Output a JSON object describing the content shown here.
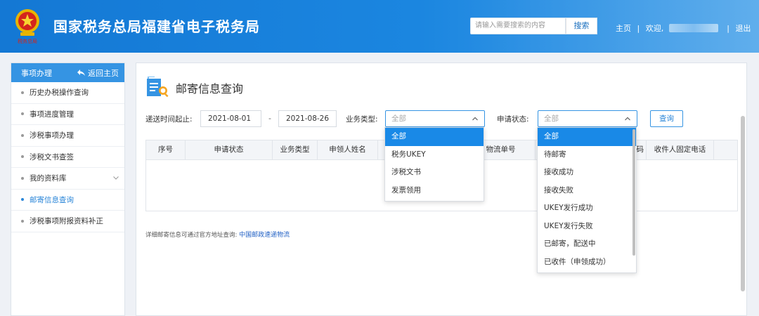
{
  "header": {
    "title": "国家税务总局福建省电子税务局",
    "emblem_caption": "税务总局",
    "search_placeholder": "请输入需要搜索的内容",
    "search_button": "搜索",
    "home": "主页",
    "sep1": "|",
    "welcome": "欢迎,",
    "sep2": "|",
    "logout": "退出"
  },
  "sidebar": {
    "section_title": "事项办理",
    "back_label": "返回主页",
    "items": [
      {
        "label": "历史办税操作查询"
      },
      {
        "label": "事项进度管理"
      },
      {
        "label": "涉税事项办理"
      },
      {
        "label": "涉税文书查签"
      },
      {
        "label": "我的资料库"
      },
      {
        "label": "邮寄信息查询"
      },
      {
        "label": "涉税事项附报资料补正"
      }
    ]
  },
  "main": {
    "title": "邮寄信息查询",
    "filters": {
      "date_label": "递送时间起止:",
      "date_from": "2021-08-01",
      "date_sep": "-",
      "date_to": "2021-08-26",
      "biz_type_label": "业务类型:",
      "biz_type_value": "全部",
      "status_label": "申请状态:",
      "status_value": "全部",
      "query_button": "查询"
    },
    "table": {
      "columns": [
        "序号",
        "申请状态",
        "业务类型",
        "申领人姓名",
        "",
        "物流单号",
        "",
        "码",
        "收件人固定电话"
      ]
    },
    "note_text": "详细邮寄信息可通过官方地址查询:",
    "note_link": "中国邮政速递物流"
  },
  "biz_type_dropdown": {
    "options": [
      "全部",
      "税务UKEY",
      "涉税文书",
      "发票领用"
    ],
    "selected": "全部"
  },
  "status_dropdown": {
    "options": [
      "全部",
      "待邮寄",
      "接收成功",
      "接收失败",
      "UKEY发行成功",
      "UKEY发行失败",
      "已邮寄，配送中",
      "已收件（申领成功）"
    ],
    "selected": "全部"
  },
  "colors": {
    "header_blue": "#1478d4",
    "accent": "#3594e3",
    "selected_option": "#1989e7",
    "link": "#1f5fc4"
  }
}
